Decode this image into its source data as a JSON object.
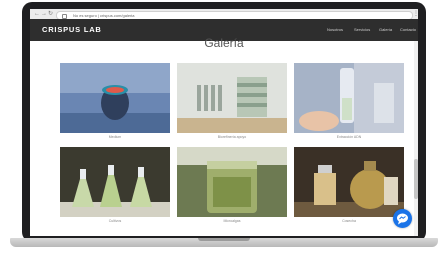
{
  "browser": {
    "url": "No es seguro | crispus.com/galeria"
  },
  "site": {
    "brand": "CRISPUS LAB",
    "nav": [
      "Nosotros",
      "Servicios",
      "Galería",
      "Contacto"
    ]
  },
  "page": {
    "title": "Galería"
  },
  "gallery": [
    {
      "caption": "Medium"
    },
    {
      "caption": "Biorefinería apoyo"
    },
    {
      "caption": "Extracción ADN"
    },
    {
      "caption": "Cultivos"
    },
    {
      "caption": "Microalgas"
    },
    {
      "caption": "Cosecha"
    }
  ]
}
